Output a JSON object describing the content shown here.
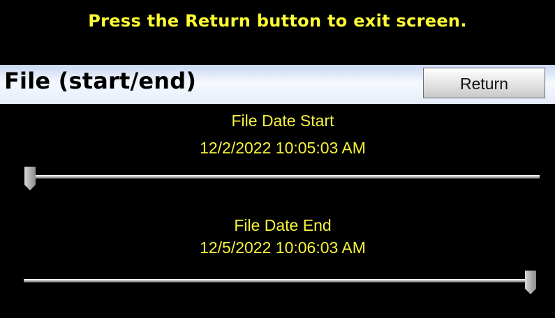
{
  "banner": {
    "text": "Press the Return button to exit screen."
  },
  "header": {
    "title": "File (start/end)",
    "return_label": "Return"
  },
  "start": {
    "label": "File Date Start",
    "value": "12/2/2022 10:05:03 AM",
    "slider_position": 0.0
  },
  "end": {
    "label": "File Date End",
    "value": "12/5/2022 10:06:03 AM",
    "slider_position": 1.0
  },
  "colors": {
    "background": "#000000",
    "text_accent": "#ffff33",
    "title_bar": "#e6edf9"
  }
}
